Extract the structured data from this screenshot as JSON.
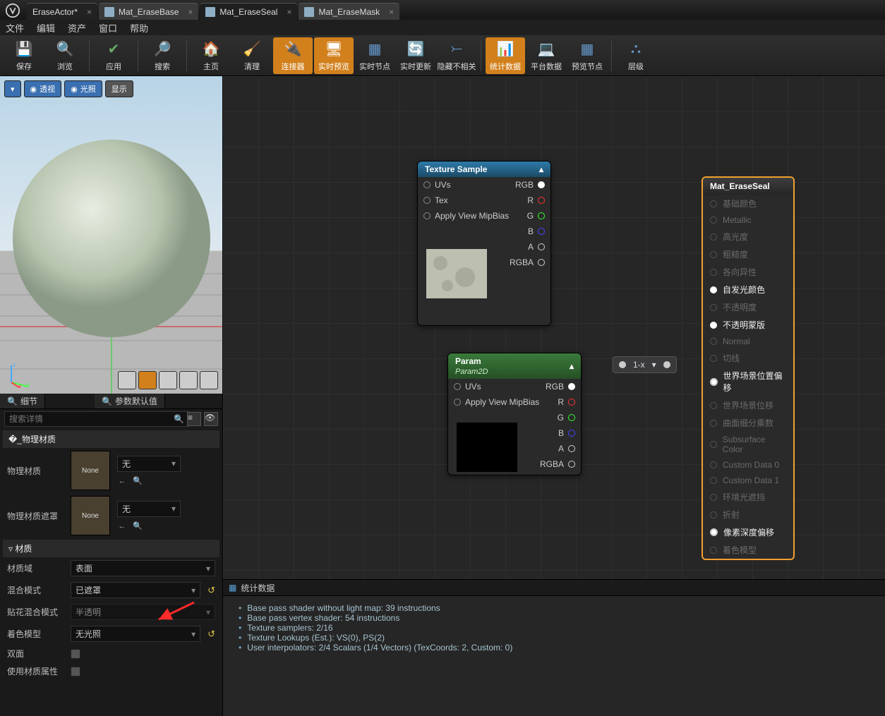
{
  "tabs": [
    {
      "label": "EraseActor*"
    },
    {
      "label": "Mat_EraseBase"
    },
    {
      "label": "Mat_EraseSeal"
    },
    {
      "label": "Mat_EraseMask"
    }
  ],
  "menu": [
    "文件",
    "编辑",
    "资产",
    "窗口",
    "帮助"
  ],
  "toolbar": [
    {
      "label": "保存"
    },
    {
      "label": "浏览"
    },
    {
      "label": "应用"
    },
    {
      "label": "搜索"
    },
    {
      "label": "主页"
    },
    {
      "label": "清理"
    },
    {
      "label": "连接器",
      "active": true
    },
    {
      "label": "实时预览",
      "active": true
    },
    {
      "label": "实时节点"
    },
    {
      "label": "实时更新"
    },
    {
      "label": "隐藏不相关"
    },
    {
      "label": "统计数据",
      "active": true
    },
    {
      "label": "平台数据"
    },
    {
      "label": "预览节点"
    },
    {
      "label": "层级"
    }
  ],
  "viewport": {
    "btn_expand": "",
    "btn_perspective": "透视",
    "btn_lit": "光照",
    "btn_show": "显示"
  },
  "panel_tabs": {
    "details": "细节",
    "defaults": "参数默认值"
  },
  "search_placeholder": "搜索详情",
  "categories": {
    "physmat": "物理材质",
    "material": "材质"
  },
  "props": {
    "phys_mat_label": "物理材质",
    "phys_mask_label": "物理材质遮罩",
    "none": "None",
    "none_combo": "无",
    "mat_domain_label": "材质域",
    "mat_domain_value": "表面",
    "blend_label": "混合模式",
    "blend_value": "已遮罩",
    "decal_blend_label": "贴花混合模式",
    "decal_blend_value": "半透明",
    "shading_label": "着色模型",
    "shading_value": "无光照",
    "two_sided_label": "双面",
    "use_mat_attr_label": "使用材质属性"
  },
  "nodes": {
    "tex": {
      "title": "Texture Sample",
      "in": [
        "UVs",
        "Tex",
        "Apply View MipBias"
      ],
      "out": [
        "RGB",
        "R",
        "G",
        "B",
        "A",
        "RGBA"
      ]
    },
    "param": {
      "title": "Param",
      "subtitle": "Param2D",
      "in": [
        "UVs",
        "Apply View MipBias"
      ],
      "out": [
        "RGB",
        "R",
        "G",
        "B",
        "A",
        "RGBA"
      ]
    },
    "oneminus": "1-x",
    "result": {
      "title": "Mat_EraseSeal",
      "pins": [
        {
          "t": "基础颜色",
          "on": false
        },
        {
          "t": "Metallic",
          "on": false
        },
        {
          "t": "高光度",
          "on": false
        },
        {
          "t": "粗糙度",
          "on": false
        },
        {
          "t": "各向异性",
          "on": false
        },
        {
          "t": "自发光颜色",
          "on": true
        },
        {
          "t": "不透明度",
          "on": false
        },
        {
          "t": "不透明蒙版",
          "on": true
        },
        {
          "t": "Normal",
          "on": false
        },
        {
          "t": "切线",
          "on": false
        },
        {
          "t": "世界场景位置偏移",
          "on": true,
          "bold": true
        },
        {
          "t": "世界场景位移",
          "on": false
        },
        {
          "t": "曲面细分乘数",
          "on": false
        },
        {
          "t": "Subsurface Color",
          "on": false
        },
        {
          "t": "Custom Data 0",
          "on": false
        },
        {
          "t": "Custom Data 1",
          "on": false
        },
        {
          "t": "环境光遮挡",
          "on": false
        },
        {
          "t": "折射",
          "on": false
        },
        {
          "t": "像素深度偏移",
          "on": true,
          "bold": true
        },
        {
          "t": "着色模型",
          "on": false
        }
      ]
    }
  },
  "stats": {
    "title": "统计数据",
    "lines": [
      "Base pass shader without light map: 39 instructions",
      "Base pass vertex shader: 54 instructions",
      "Texture samplers: 2/16",
      "Texture Lookups (Est.): VS(0), PS(2)",
      "User interpolators: 2/4 Scalars (1/4 Vectors) (TexCoords: 2, Custom: 0)"
    ]
  }
}
